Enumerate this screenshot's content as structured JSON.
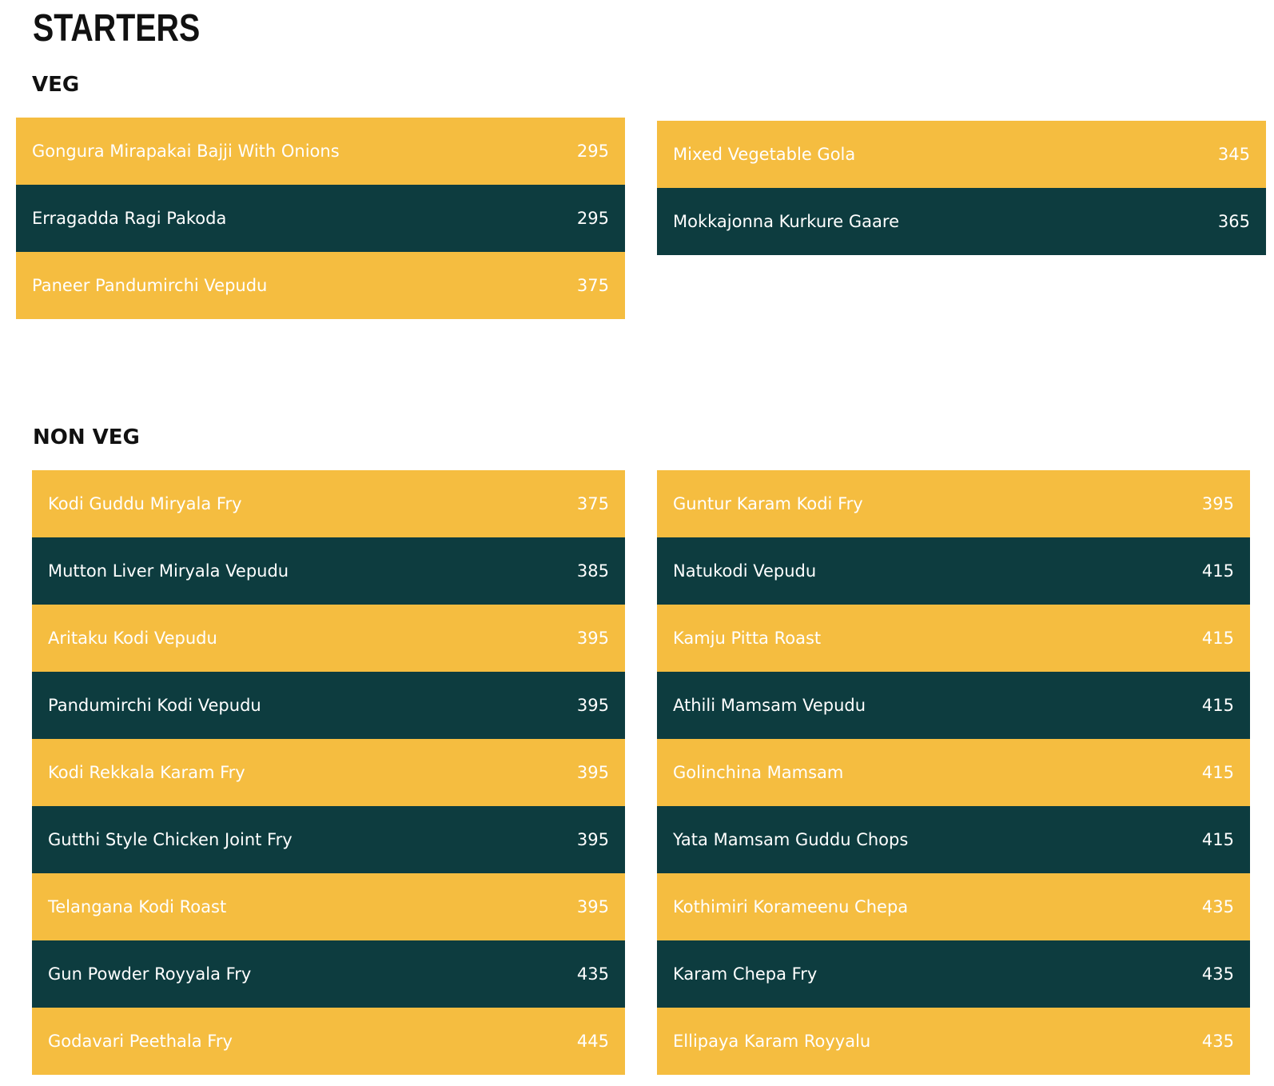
{
  "page": {
    "title": "STARTERS"
  },
  "veg": {
    "heading": "VEG",
    "left": [
      {
        "name": "Gongura Mirapakai Bajji With Onions",
        "price": "295",
        "style": "yellow"
      },
      {
        "name": "Erragadda Ragi Pakoda",
        "price": "295",
        "style": "dark"
      },
      {
        "name": "Paneer Pandumirchi Vepudu",
        "price": "375",
        "style": "yellow"
      }
    ],
    "right": [
      {
        "name": "Mixed Vegetable Gola",
        "price": "345",
        "style": "yellow"
      },
      {
        "name": "Mokkajonna Kurkure Gaare",
        "price": "365",
        "style": "dark"
      }
    ]
  },
  "nonveg": {
    "heading": "NON VEG",
    "left": [
      {
        "name": "Kodi Guddu Miryala Fry",
        "price": "375",
        "style": "yellow"
      },
      {
        "name": "Mutton Liver Miryala Vepudu",
        "price": "385",
        "style": "dark"
      },
      {
        "name": "Aritaku Kodi Vepudu",
        "price": "395",
        "style": "yellow"
      },
      {
        "name": "Pandumirchi Kodi Vepudu",
        "price": "395",
        "style": "dark"
      },
      {
        "name": "Kodi Rekkala Karam Fry",
        "price": "395",
        "style": "yellow"
      },
      {
        "name": "Gutthi Style Chicken Joint Fry",
        "price": "395",
        "style": "dark"
      },
      {
        "name": "Telangana Kodi Roast",
        "price": "395",
        "style": "yellow"
      },
      {
        "name": "Gun Powder Royyala Fry",
        "price": "435",
        "style": "dark"
      },
      {
        "name": "Godavari Peethala Fry",
        "price": "445",
        "style": "yellow"
      }
    ],
    "right": [
      {
        "name": "Guntur Karam Kodi Fry",
        "price": "395",
        "style": "yellow"
      },
      {
        "name": "Natukodi Vepudu",
        "price": "415",
        "style": "dark"
      },
      {
        "name": "Kamju Pitta Roast",
        "price": "415",
        "style": "yellow"
      },
      {
        "name": "Athili Mamsam Vepudu",
        "price": "415",
        "style": "dark"
      },
      {
        "name": "Golinchina Mamsam",
        "price": "415",
        "style": "yellow"
      },
      {
        "name": "Yata Mamsam Guddu Chops",
        "price": "415",
        "style": "dark"
      },
      {
        "name": "Kothimiri Korameenu Chepa",
        "price": "435",
        "style": "yellow"
      },
      {
        "name": "Karam Chepa Fry",
        "price": "435",
        "style": "dark"
      },
      {
        "name": "Ellipaya Karam Royyalu",
        "price": "435",
        "style": "yellow"
      }
    ]
  },
  "colors": {
    "yellow": "#f5bd40",
    "dark": "#0d3c3f",
    "text_on_row": "#ffffff",
    "heading": "#111111"
  }
}
